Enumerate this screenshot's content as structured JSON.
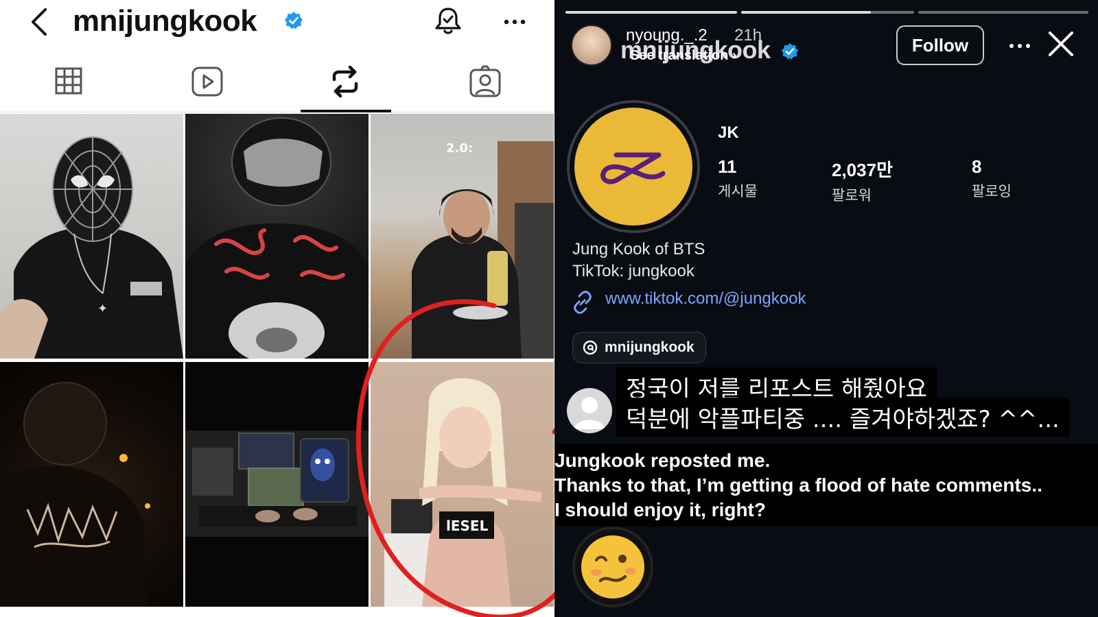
{
  "left": {
    "header": {
      "username": "mnijungkook"
    },
    "tabs": [
      {
        "name": "grid",
        "icon": "grid-icon"
      },
      {
        "name": "reels",
        "icon": "reels-icon"
      },
      {
        "name": "reposts",
        "icon": "repost-icon",
        "active": true
      },
      {
        "name": "tagged",
        "icon": "tagged-icon"
      }
    ],
    "grid": {
      "cell3_caption": "2.0:"
    }
  },
  "right": {
    "story": {
      "username": "nyoung._.2",
      "time": "21h",
      "overlay_name": "mnijungkook",
      "see_translation": "See translation",
      "follow_label": "Follow",
      "progress": [
        1.0,
        0.75,
        0.0
      ]
    },
    "profile": {
      "display_name": "JK",
      "stats": {
        "posts": {
          "value": "11",
          "label": "게시물"
        },
        "followers": {
          "value": "2,037만",
          "label": "팔로워"
        },
        "following": {
          "value": "8",
          "label": "팔로잉"
        }
      },
      "bio": [
        "Jung Kook of BTS",
        "TikTok: jungkook"
      ],
      "link": "www.tiktok.com/@jungkook",
      "threads_handle": "mnijungkook"
    },
    "captions": {
      "korean": [
        "정국이 저를 리포스트 해줬아요",
        "덕분에 악플파티중 .... 즐겨야하겠죠? ^^..."
      ],
      "english": [
        "Jungkook reposted me.",
        "Thanks to that, I’m getting a flood of hate comments..",
        "I should enjoy it, right?"
      ]
    },
    "colors": {
      "verified": "#1d9bf0",
      "link": "#7aa6ff",
      "avatar_bg": "#eab937",
      "logo": "#5a1f7a",
      "highlight_circle": "#e02020"
    }
  }
}
